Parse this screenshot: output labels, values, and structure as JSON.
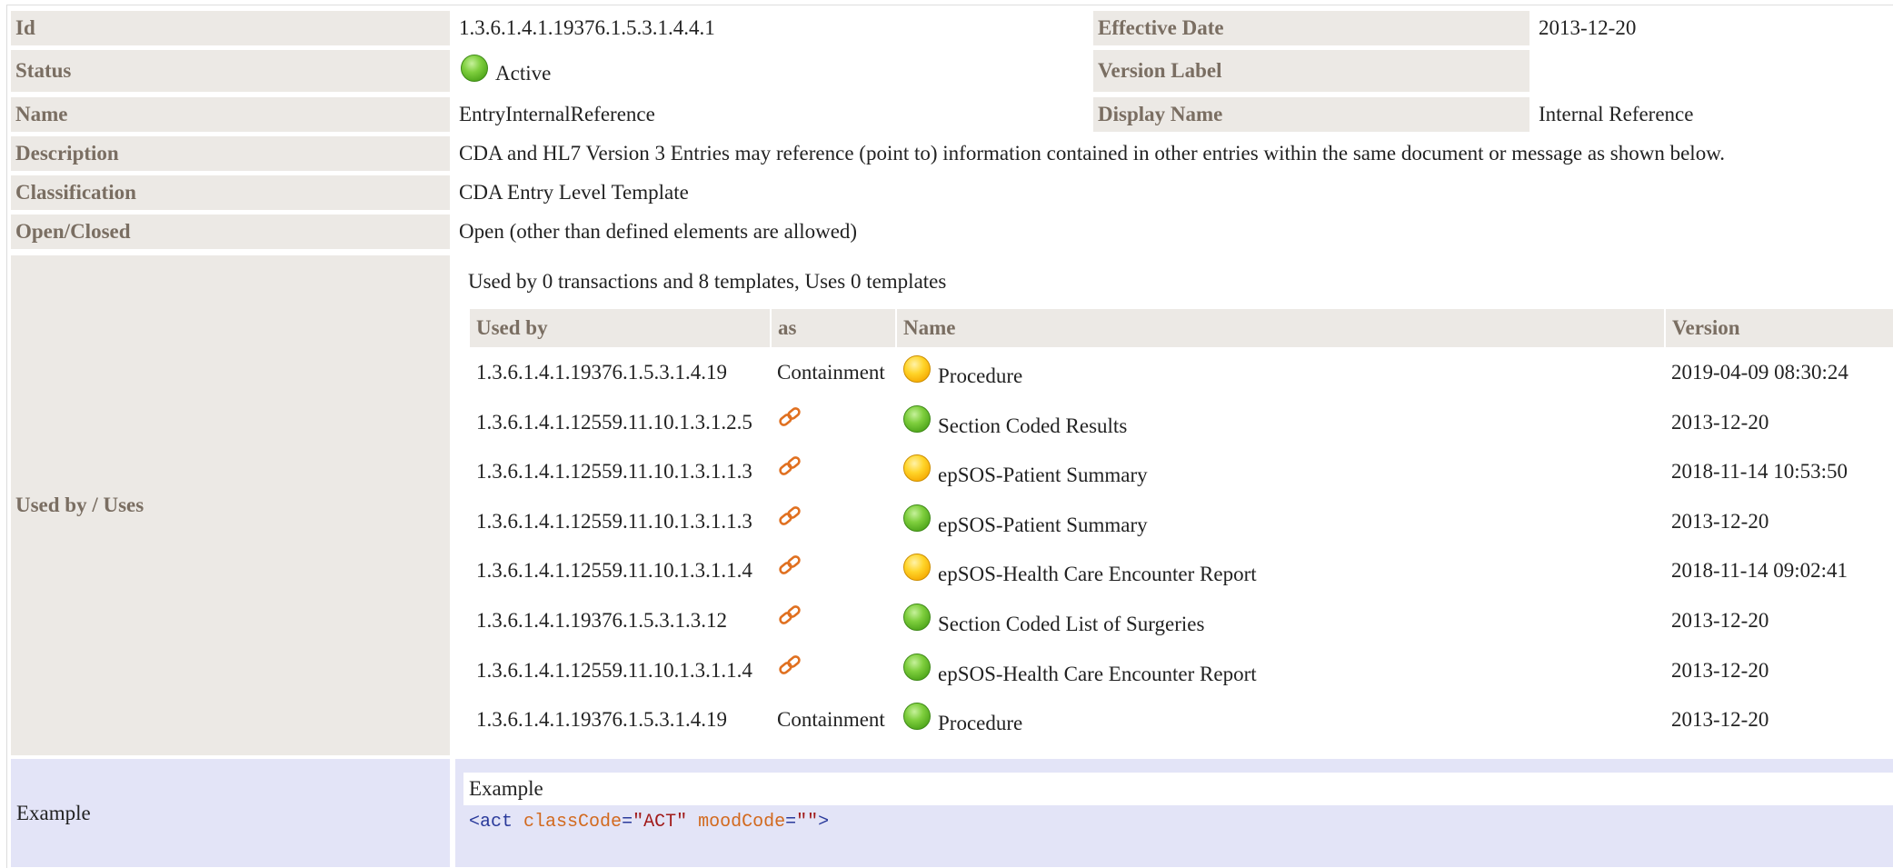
{
  "template": {
    "id": {
      "label": "Id",
      "value": "1.3.6.1.4.1.19376.1.5.3.1.4.4.1"
    },
    "effective_date": {
      "label": "Effective Date",
      "value": "2013-12-20"
    },
    "status": {
      "label": "Status",
      "value": "Active",
      "color": "green"
    },
    "version_label": {
      "label": "Version Label",
      "value": ""
    },
    "name": {
      "label": "Name",
      "value": "EntryInternalReference"
    },
    "display_name": {
      "label": "Display Name",
      "value": "Internal Reference"
    },
    "description": {
      "label": "Description",
      "value": "CDA and HL7 Version 3 Entries may reference (point to) information contained in other entries within the same document or message as shown below."
    },
    "classification": {
      "label": "Classification",
      "value": "CDA Entry Level Template"
    },
    "open_closed": {
      "label": "Open/Closed",
      "value": "Open (other than defined elements are allowed)"
    }
  },
  "used_by": {
    "label": "Used by / Uses",
    "summary": "Used by 0 transactions and 8 templates, Uses 0 templates",
    "columns": [
      "Used by",
      "as",
      "Name",
      "Version"
    ],
    "rows": [
      {
        "id": "1.3.6.1.4.1.19376.1.5.3.1.4.19",
        "as": "Containment",
        "as_icon": "",
        "status": "yellow",
        "name": "Procedure",
        "version": "2019-04-09 08:30:24"
      },
      {
        "id": "1.3.6.1.4.1.12559.11.10.1.3.1.2.5",
        "as": "",
        "as_icon": "link-icon",
        "status": "green",
        "name": "Section Coded Results",
        "version": "2013-12-20"
      },
      {
        "id": "1.3.6.1.4.1.12559.11.10.1.3.1.1.3",
        "as": "",
        "as_icon": "link-icon",
        "status": "yellow",
        "name": "epSOS-Patient Summary",
        "version": "2018-11-14 10:53:50"
      },
      {
        "id": "1.3.6.1.4.1.12559.11.10.1.3.1.1.3",
        "as": "",
        "as_icon": "link-icon",
        "status": "green",
        "name": "epSOS-Patient Summary",
        "version": "2013-12-20"
      },
      {
        "id": "1.3.6.1.4.1.12559.11.10.1.3.1.1.4",
        "as": "",
        "as_icon": "link-icon",
        "status": "yellow",
        "name": "epSOS-Health Care Encounter Report",
        "version": "2018-11-14 09:02:41"
      },
      {
        "id": "1.3.6.1.4.1.19376.1.5.3.1.3.12",
        "as": "",
        "as_icon": "link-icon",
        "status": "green",
        "name": "Section Coded List of Surgeries",
        "version": "2013-12-20"
      },
      {
        "id": "1.3.6.1.4.1.12559.11.10.1.3.1.1.4",
        "as": "",
        "as_icon": "link-icon",
        "status": "green",
        "name": "epSOS-Health Care Encounter Report",
        "version": "2013-12-20"
      },
      {
        "id": "1.3.6.1.4.1.19376.1.5.3.1.4.19",
        "as": "Containment",
        "as_icon": "",
        "status": "green",
        "name": "Procedure",
        "version": "2013-12-20"
      }
    ]
  },
  "example": {
    "label": "Example",
    "title": "Example",
    "code": {
      "tag_open": "<act",
      "attr1": "classCode",
      "val1": "\"ACT\"",
      "attr2": "moodCode",
      "val2": "\"\"",
      "tag_close": ">"
    }
  },
  "colors": {
    "label_bg": "#ece9e5",
    "label_text": "#7a6e62",
    "example_bg": "#e3e4f7",
    "status_green": "#5cb82a",
    "status_yellow": "#f5b800",
    "link_icon": "#e07020"
  }
}
